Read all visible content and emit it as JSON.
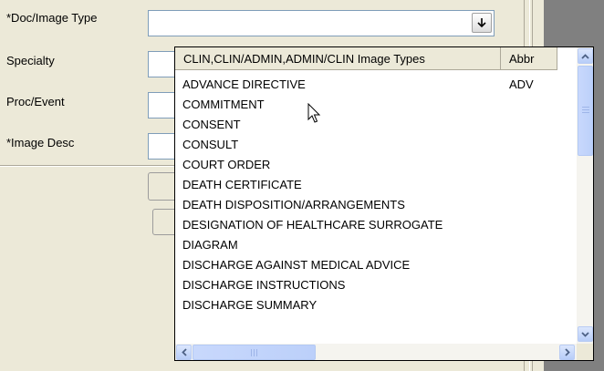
{
  "form": {
    "labels": {
      "doc_image_type": "*Doc/Image Type",
      "specialty": "Specialty",
      "proc_event": "Proc/Event",
      "image_desc": "*Image Desc"
    }
  },
  "dropdown": {
    "columns": [
      "CLIN,CLIN/ADMIN,ADMIN/CLIN Image Types",
      "Abbr"
    ],
    "rows": [
      {
        "type": "ADVANCE DIRECTIVE",
        "abbr": "ADV"
      },
      {
        "type": "COMMITMENT",
        "abbr": ""
      },
      {
        "type": "CONSENT",
        "abbr": ""
      },
      {
        "type": "CONSULT",
        "abbr": ""
      },
      {
        "type": "COURT ORDER",
        "abbr": ""
      },
      {
        "type": "DEATH CERTIFICATE",
        "abbr": ""
      },
      {
        "type": "DEATH DISPOSITION/ARRANGEMENTS",
        "abbr": ""
      },
      {
        "type": "DESIGNATION OF HEALTHCARE SURROGATE",
        "abbr": ""
      },
      {
        "type": "DIAGRAM",
        "abbr": ""
      },
      {
        "type": "DISCHARGE AGAINST MEDICAL ADVICE",
        "abbr": ""
      },
      {
        "type": "DISCHARGE INSTRUCTIONS",
        "abbr": ""
      },
      {
        "type": "DISCHARGE SUMMARY",
        "abbr": ""
      }
    ]
  },
  "icons": {
    "dropdown_button": "down-arrow-icon",
    "cursor": "mouse-pointer-icon"
  },
  "colors": {
    "window_bg": "#ECE9D8",
    "scroll_button": "#C1D3FB"
  }
}
